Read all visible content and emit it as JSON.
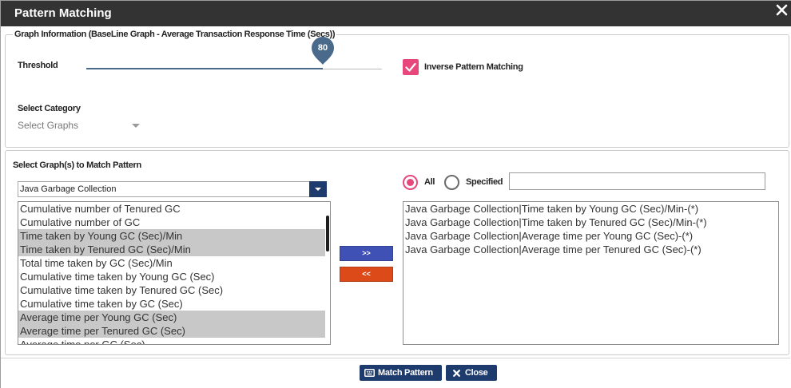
{
  "colors": {
    "title_bar": "#333333",
    "accent": "#e8477c",
    "slider": "#4a6a8c",
    "navy": "#1d3b6d",
    "move_right": "#3f51b5",
    "move_left": "#dc4a1a",
    "selected_row": "#c8c8c8"
  },
  "dialog": {
    "title": "Pattern Matching",
    "close_icon": "close-icon"
  },
  "graph_info": {
    "legend": "Graph Information (BaseLine Graph - Average Transaction Response Time (Secs))",
    "threshold": {
      "label": "Threshold",
      "value": 80
    },
    "inverse": {
      "label": "Inverse Pattern Matching",
      "checked": true
    },
    "category": {
      "label": "Select Category",
      "placeholder": "Select Graphs",
      "icon": "chevron-down-icon"
    }
  },
  "graph_selection": {
    "heading": "Select Graph(s) to Match Pattern",
    "group": {
      "value": "Java Garbage Collection",
      "icon": "chevron-down-icon"
    },
    "available": [
      {
        "label": "Cumulative number of Tenured GC",
        "selected": false
      },
      {
        "label": "Cumulative number of GC",
        "selected": false
      },
      {
        "label": "Time taken by Young GC (Sec)/Min",
        "selected": true
      },
      {
        "label": "Time taken by Tenured GC (Sec)/Min",
        "selected": true
      },
      {
        "label": "Total time taken by GC (Sec)/Min",
        "selected": false
      },
      {
        "label": "Cumulative time taken by Young GC (Sec)",
        "selected": false
      },
      {
        "label": "Cumulative time taken by Tenured GC (Sec)",
        "selected": false
      },
      {
        "label": "Cumulative time taken by GC (Sec)",
        "selected": false
      },
      {
        "label": "Average time per Young GC (Sec)",
        "selected": true
      },
      {
        "label": "Average time per Tenured GC (Sec)",
        "selected": true
      },
      {
        "label": "Average time per GC (Sec)",
        "selected": false
      }
    ],
    "add_label": ">>",
    "remove_label": "<<",
    "scope": {
      "all": {
        "label": "All",
        "checked": true
      },
      "specified": {
        "label": "Specified",
        "checked": false,
        "value": ""
      }
    },
    "chosen": [
      "Java Garbage Collection|Time taken by Young GC (Sec)/Min-(*)",
      "Java Garbage Collection|Time taken by Tenured GC (Sec)/Min-(*)",
      "Java Garbage Collection|Average time per Young GC (Sec)-(*)",
      "Java Garbage Collection|Average time per Tenured GC (Sec)-(*)"
    ]
  },
  "footer": {
    "match": {
      "label": "Match Pattern",
      "icon": "keyboard-icon"
    },
    "close": {
      "label": "Close",
      "icon": "times-icon"
    }
  }
}
